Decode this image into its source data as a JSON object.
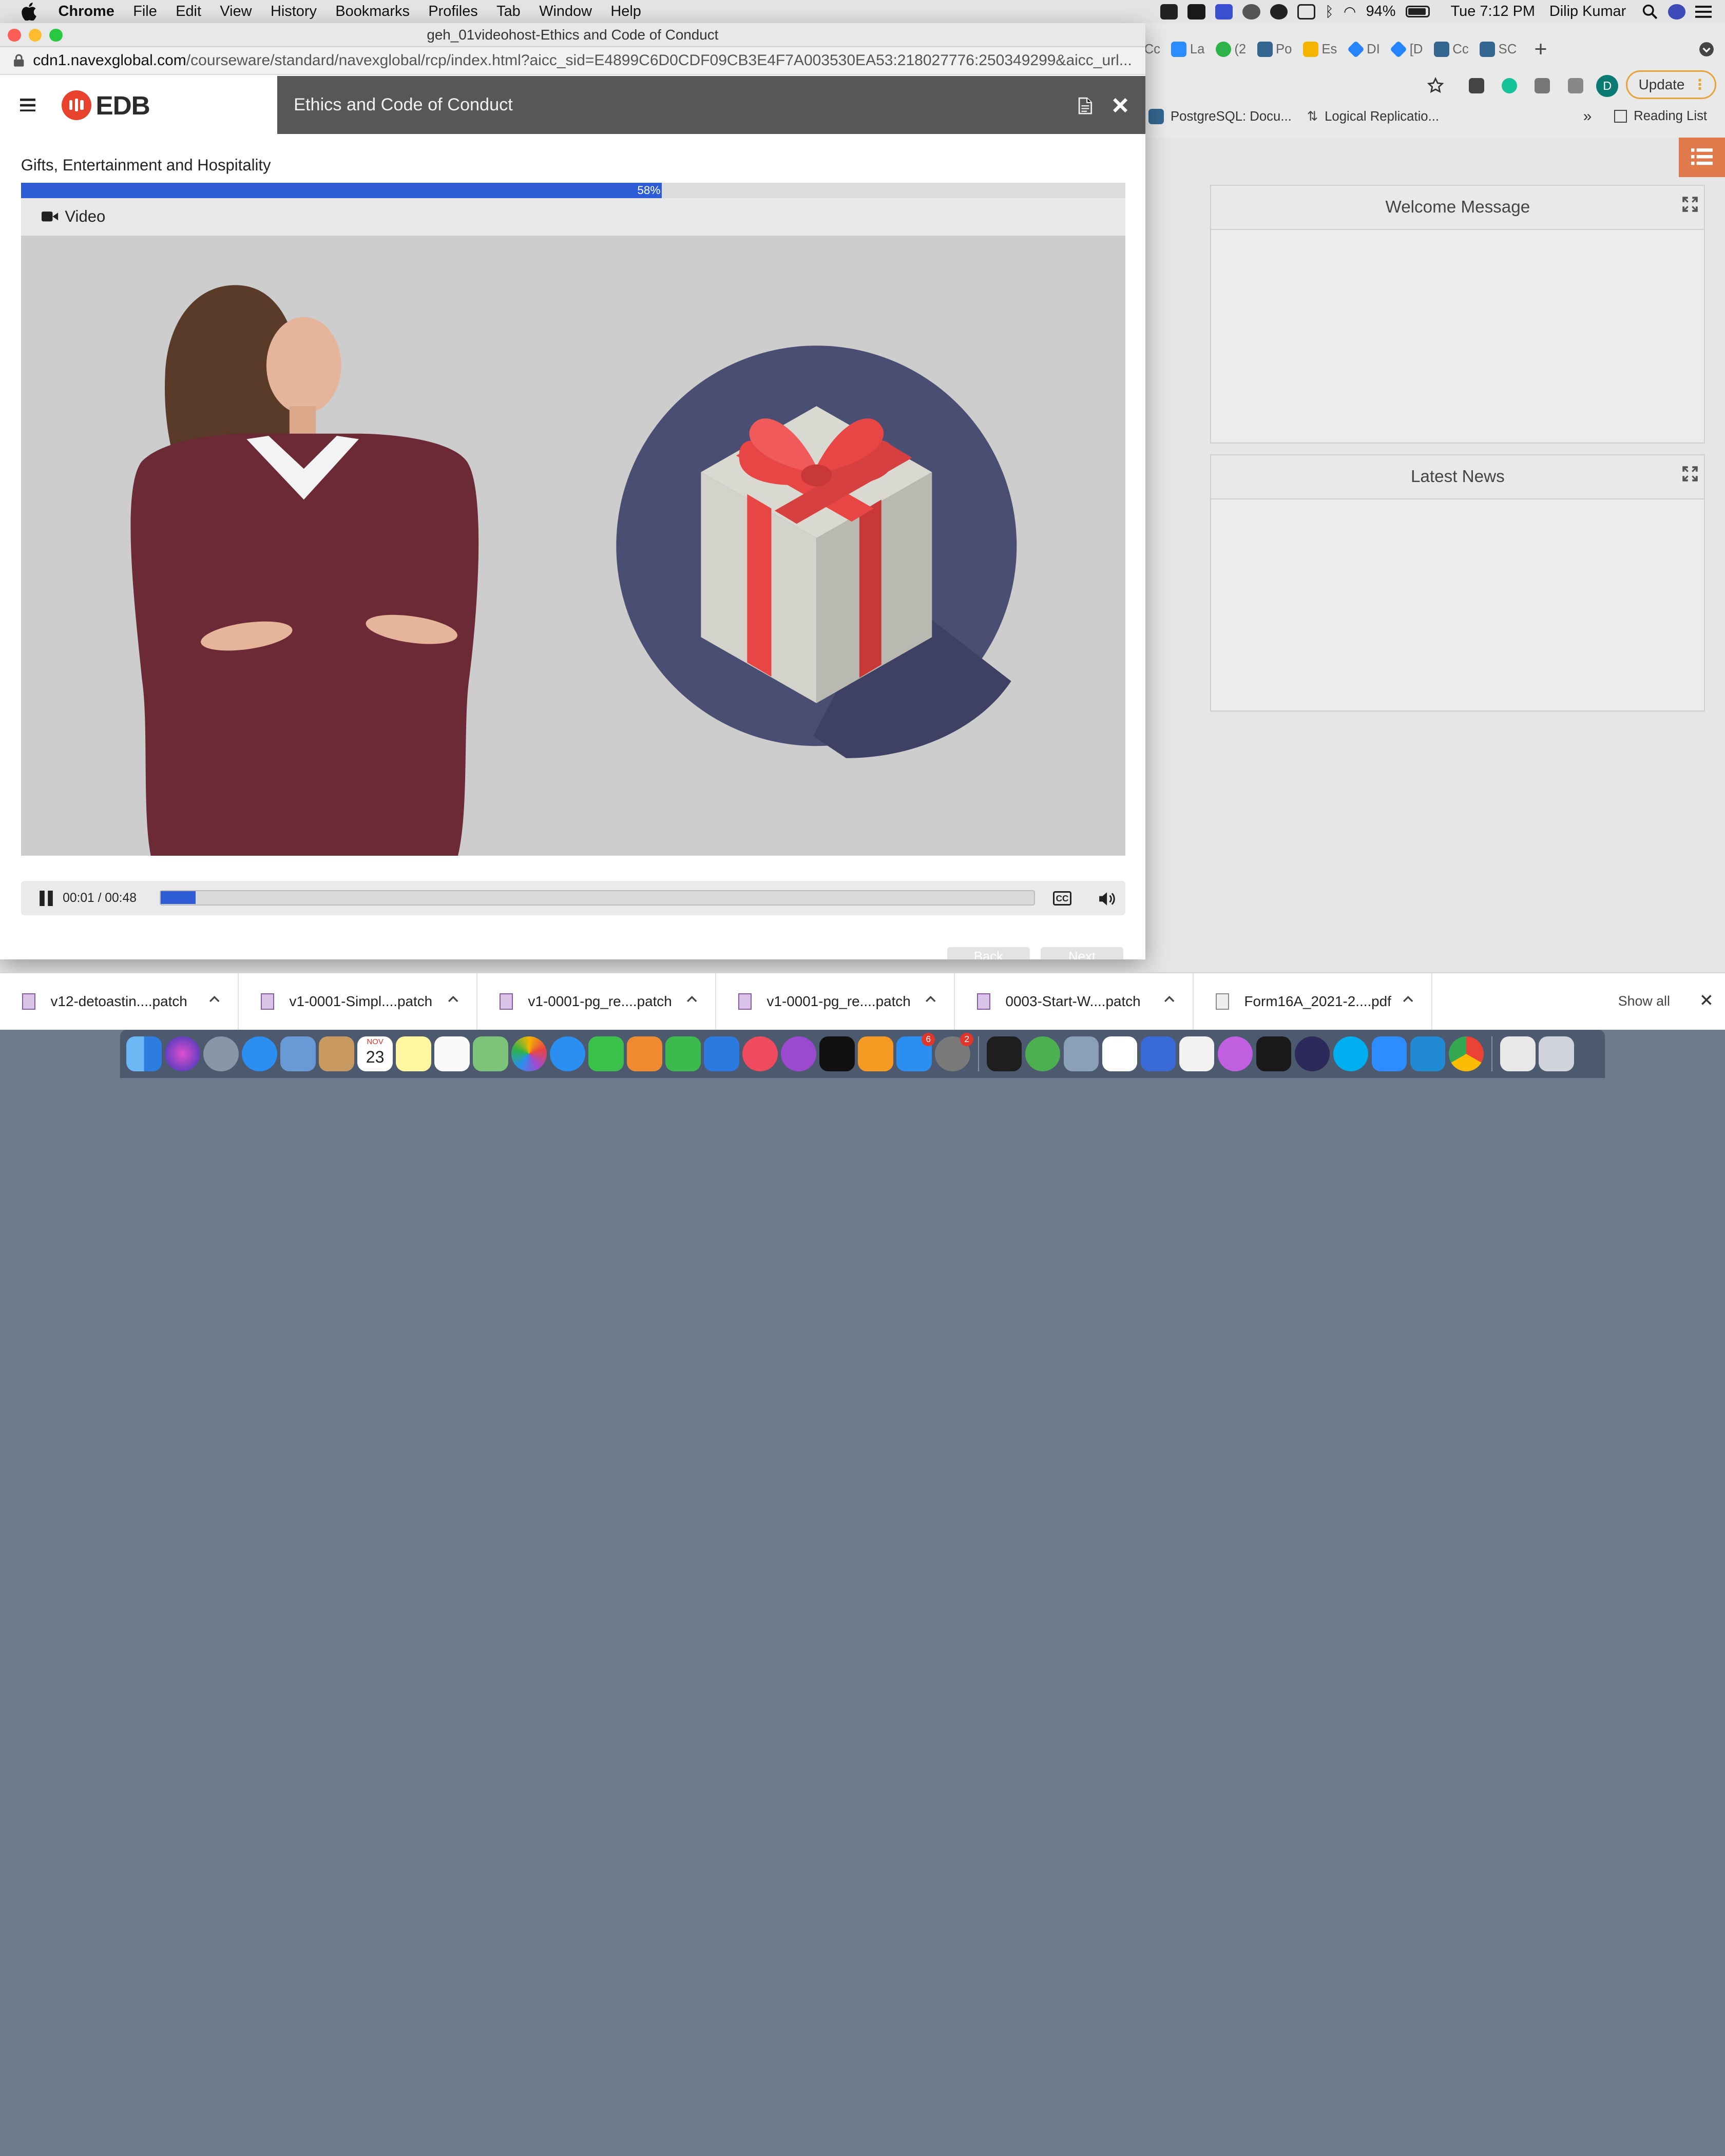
{
  "menubar": {
    "app_name": "Chrome",
    "items": [
      "File",
      "Edit",
      "View",
      "History",
      "Bookmarks",
      "Profiles",
      "Tab",
      "Window",
      "Help"
    ],
    "battery": "94%",
    "clock": "Tue 7:12 PM",
    "user": "Dilip Kumar"
  },
  "background_chrome": {
    "tabs": [
      {
        "label": "Cc",
        "icon": "generic-tab-icon"
      },
      {
        "label": "La",
        "icon": "zoom-icon"
      },
      {
        "label": "(2",
        "icon": "green-badge-icon"
      },
      {
        "label": "Po",
        "icon": "postgres-icon"
      },
      {
        "label": "Es",
        "icon": "slides-icon"
      },
      {
        "label": "DI",
        "icon": "jira-icon"
      },
      {
        "label": "[D",
        "icon": "jira-icon"
      },
      {
        "label": "Cc",
        "icon": "postgres-icon"
      },
      {
        "label": "SC",
        "icon": "postgres-icon"
      }
    ],
    "update_label": "Update",
    "profile_initial": "D",
    "bookmarks": [
      {
        "label": "PostgreSQL: Docu...",
        "icon": "postgres-icon"
      },
      {
        "label": "Logical Replicatio...",
        "icon": "git-icon"
      }
    ],
    "bookmarks_overflow": "»",
    "reading_list_label": "Reading List",
    "panels": [
      {
        "title": "Welcome Message"
      },
      {
        "title": "Latest News"
      }
    ]
  },
  "popup": {
    "window_title": "geh_01videohost-Ethics and Code of Conduct",
    "url_host": "cdn1.navexglobal.com",
    "url_path": "/courseware/standard/navexglobal/rcp/index.html?aicc_sid=E4899C6D0CDF09CB3E4F7A003530EA53:218027776:250349299&aicc_url...",
    "logo_text": "EDB",
    "course_title": "Ethics and Code of Conduct",
    "lesson_title": "Gifts, Entertainment and Hospitality",
    "progress_pct": 58,
    "progress_label": "58%",
    "video_label": "Video",
    "player": {
      "time": "00:01 / 00:48",
      "seek_fraction": 0.04
    },
    "nav_buttons": [
      "Back",
      "Next"
    ]
  },
  "downloads": {
    "items": [
      "v12-detoastin....patch",
      "v1-0001-Simpl....patch",
      "v1-0001-pg_re....patch",
      "v1-0001-pg_re....patch",
      "0003-Start-W....patch",
      "Form16A_2021-2....pdf"
    ],
    "show_all_label": "Show all"
  },
  "dock": {
    "calendar_day": "23",
    "calendar_month": "NOV",
    "appstore_badge": "6",
    "settings_badge": "2"
  },
  "colors": {
    "accent_blue": "#2e5cd6",
    "header_gray": "#575757",
    "edb_red": "#e8412c",
    "gift_circle": "#4a4e72",
    "ribbon_red": "#e84545",
    "sidebar_orange": "#e07a4a"
  }
}
